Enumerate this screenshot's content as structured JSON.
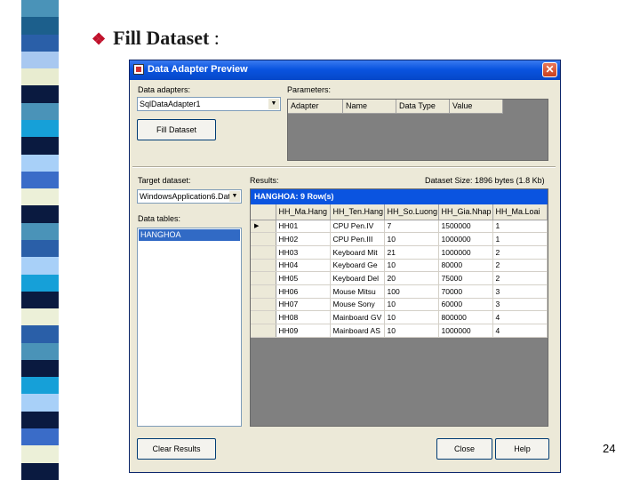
{
  "slide": {
    "title": "Fill Dataset",
    "title_colon": " :",
    "bullet_icon": "diamond-bullet",
    "page_number": "24"
  },
  "stripe_colors": [
    "#4a93b8",
    "#1c5f8c",
    "#2a5fa8",
    "#a8c8f0",
    "#e8ecd0",
    "#0a1a40",
    "#4a93b8",
    "#16a0d8",
    "#0a1a40",
    "#a8d0f8",
    "#3a6cc8",
    "#ecf0d8",
    "#0a1a40",
    "#4a93b8",
    "#2a5fa8",
    "#a8d0f8",
    "#16a0d8",
    "#0a1a40",
    "#ecf0d8",
    "#2a5fa8",
    "#4a93b8",
    "#0a1a40",
    "#16a0d8",
    "#a8d0f8",
    "#0a1a40",
    "#3a6cc8",
    "#ecf0d8",
    "#0a1a40"
  ],
  "dialog": {
    "title": "Data Adapter Preview",
    "close_glyph": "✕",
    "data_adapters_label": "Data adapters:",
    "data_adapter_value": "SqlDataAdapter1",
    "parameters_label": "Parameters:",
    "param_columns": [
      "Adapter",
      "Name",
      "Data Type",
      "Value"
    ],
    "fill_button": "Fill Dataset",
    "target_dataset_label": "Target dataset:",
    "target_dataset_value": "WindowsApplication6.Dat",
    "results_label": "Results:",
    "dataset_size": "Dataset Size: 1896 bytes (1.8 Kb)",
    "data_tables_label": "Data tables:",
    "data_tables": [
      "HANGHOA"
    ],
    "results_caption": "HANGHOA: 9 Row(s)",
    "clear_button": "Clear Results",
    "close_button": "Close",
    "help_button": "Help",
    "dropdown_arrow": "▼",
    "row_pointer": "▶"
  },
  "results": {
    "columns": [
      "HH_Ma.Hang",
      "HH_Ten.Hang",
      "HH_So.Luong",
      "HH_Gia.Nhap",
      "HH_Ma.Loai"
    ],
    "rows": [
      [
        "HH01",
        "CPU Pen.IV",
        "7",
        "1500000",
        "1"
      ],
      [
        "HH02",
        "CPU Pen.III",
        "10",
        "1000000",
        "1"
      ],
      [
        "HH03",
        "Keyboard Mit",
        "21",
        "1000000",
        "2"
      ],
      [
        "HH04",
        "Keyboard Ge",
        "10",
        "80000",
        "2"
      ],
      [
        "HH05",
        "Keyboard Del",
        "20",
        "75000",
        "2"
      ],
      [
        "HH06",
        "Mouse Mitsu",
        "100",
        "70000",
        "3"
      ],
      [
        "HH07",
        "Mouse Sony",
        "10",
        "60000",
        "3"
      ],
      [
        "HH08",
        "Mainboard GV",
        "10",
        "800000",
        "4"
      ],
      [
        "HH09",
        "Mainboard AS",
        "10",
        "1000000",
        "4"
      ]
    ]
  }
}
